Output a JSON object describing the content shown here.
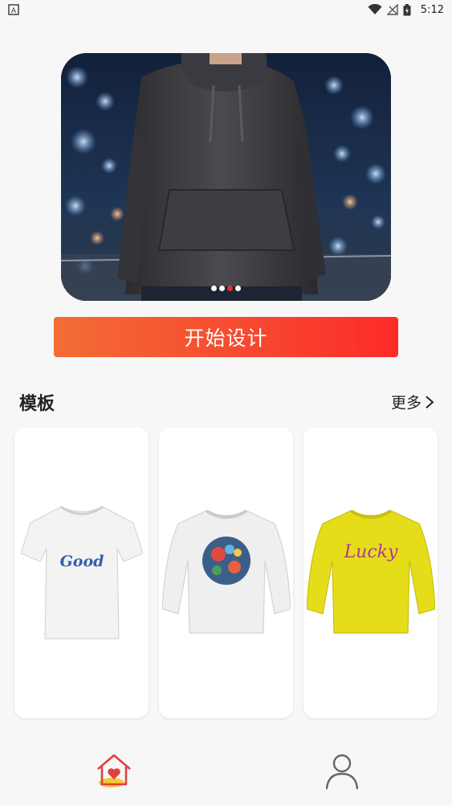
{
  "status_bar": {
    "time": "5:12",
    "icons": [
      "notification-a-icon",
      "wifi-icon",
      "signal-icon",
      "battery-icon"
    ]
  },
  "banner": {
    "slide_count": 4,
    "active_slide": 3,
    "image_subject": "person-in-dark-hoodie"
  },
  "cta": {
    "label": "开始设计"
  },
  "templates": {
    "title": "模板",
    "more_label": "更多",
    "items": [
      {
        "type": "t-shirt",
        "color": "#f4f4f4",
        "print_text": "Good"
      },
      {
        "type": "sweatshirt",
        "color": "#f0f0f0",
        "print_text": ""
      },
      {
        "type": "sweatshirt",
        "color": "#e6dd1a",
        "print_text": "Lucky"
      }
    ]
  },
  "colors": {
    "accent_start": "#f26d35",
    "accent_end": "#ff2a27",
    "active_dot": "#e23030",
    "home_icon": "#e04040"
  },
  "tab_bar": {
    "items": [
      {
        "name": "home",
        "icon": "home-heart-icon",
        "active": true
      },
      {
        "name": "profile",
        "icon": "user-icon",
        "active": false
      }
    ]
  }
}
